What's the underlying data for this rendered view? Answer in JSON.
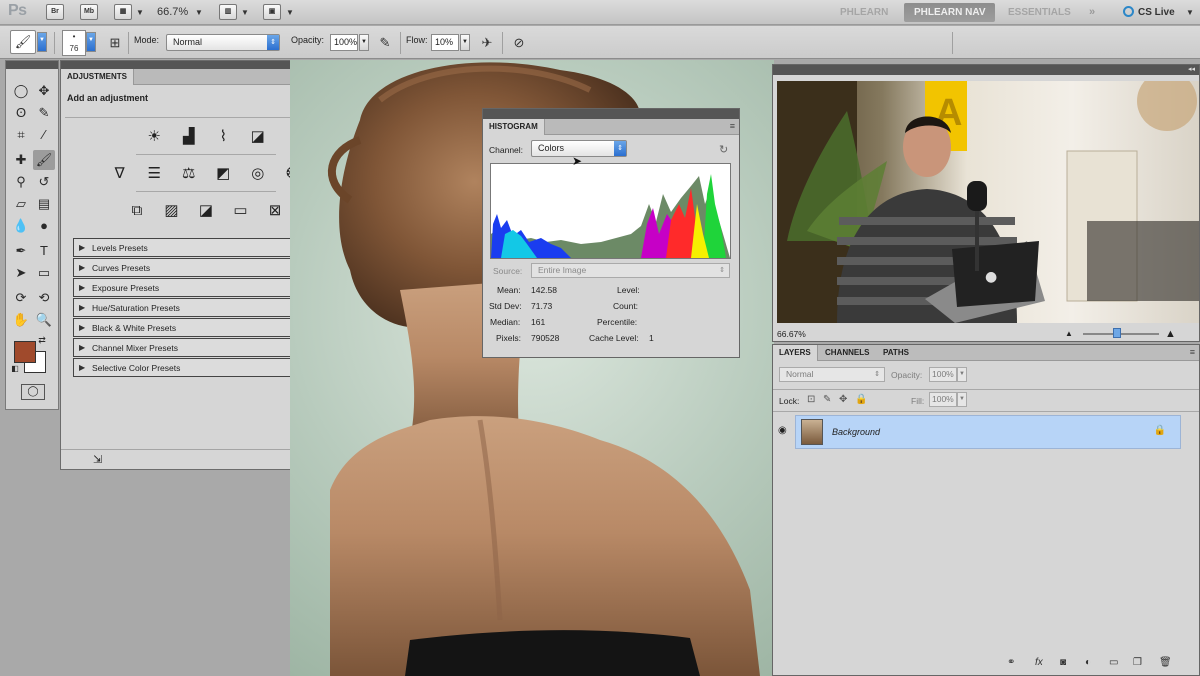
{
  "appbar": {
    "logo": "Ps",
    "bridge": "Br",
    "minibridge": "Mb",
    "zoom": "66.7%",
    "workspaces": [
      "PHLEARN",
      "PHLEARN NAV",
      "ESSENTIALS"
    ],
    "active_workspace": "PHLEARN NAV",
    "overflow": "»",
    "cs_live": "CS Live"
  },
  "options": {
    "brush_size": "76",
    "mode_label": "Mode:",
    "mode_value": "Normal",
    "opacity_label": "Opacity:",
    "opacity_value": "100%",
    "flow_label": "Flow:",
    "flow_value": "10%"
  },
  "tools": {
    "foreground_color": "#a04a2c",
    "background_color": "#ffffff"
  },
  "adjustments": {
    "tab": "ADJUSTMENTS",
    "title": "Add an adjustment",
    "presets": [
      "Levels Presets",
      "Curves Presets",
      "Exposure Presets",
      "Hue/Saturation Presets",
      "Black & White Presets",
      "Channel Mixer Presets",
      "Selective Color Presets"
    ]
  },
  "histogram": {
    "tab": "HISTOGRAM",
    "channel_label": "Channel:",
    "channel_value": "Colors",
    "source_label": "Source:",
    "source_value": "Entire Image",
    "stats": {
      "mean_label": "Mean:",
      "mean": "142.58",
      "stddev_label": "Std Dev:",
      "stddev": "71.73",
      "median_label": "Median:",
      "median": "161",
      "pixels_label": "Pixels:",
      "pixels": "790528",
      "level_label": "Level:",
      "level": "",
      "count_label": "Count:",
      "count": "",
      "percentile_label": "Percentile:",
      "percentile": "",
      "cache_label": "Cache Level:",
      "cache": "1"
    }
  },
  "navigator": {
    "zoom": "66.67%"
  },
  "layers": {
    "tabs": [
      "LAYERS",
      "CHANNELS",
      "PATHS"
    ],
    "blend_mode": "Normal",
    "opacity_label": "Opacity:",
    "opacity_value": "100%",
    "lock_label": "Lock:",
    "fill_label": "Fill:",
    "fill_value": "100%",
    "layer_name": "Background"
  },
  "video_caption_logo": "A",
  "icons": {
    "brush": "brush-icon",
    "eye": "eye-icon",
    "lock": "lock-icon"
  }
}
